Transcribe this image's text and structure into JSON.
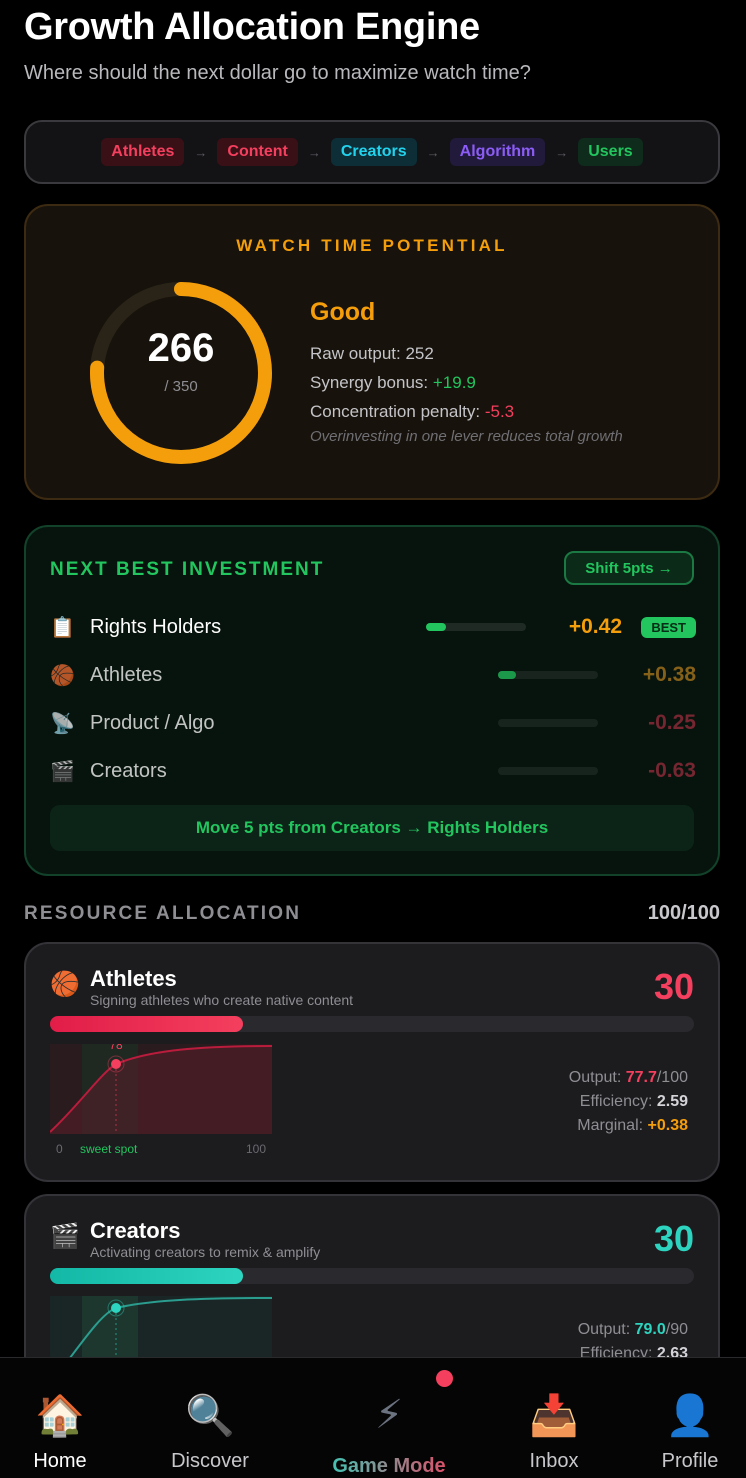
{
  "header": {
    "title": "Growth Allocation Engine",
    "subtitle": "Where should the next dollar go to maximize watch time?"
  },
  "flow": [
    {
      "label": "Athletes",
      "color": "#f43f5e",
      "bg": "#3a1017"
    },
    {
      "label": "Content",
      "color": "#f43f5e",
      "bg": "#3a1017"
    },
    {
      "label": "Creators",
      "color": "#22d3ee",
      "bg": "#0d2e36"
    },
    {
      "label": "Algorithm",
      "color": "#8b5cf6",
      "bg": "#221a3b"
    },
    {
      "label": "Users",
      "color": "#22c55e",
      "bg": "#0e2b1b"
    }
  ],
  "flow_arrow": "→",
  "watch_time": {
    "label": "WATCH TIME POTENTIAL",
    "score": "266",
    "max": "/ 350",
    "score_fraction": 0.76,
    "rating": "Good",
    "raw_label": "Raw output: ",
    "raw_value": "252",
    "synergy_label": "Synergy bonus: ",
    "synergy_value": "+19.9",
    "penalty_label": "Concentration penalty: ",
    "penalty_value": "-5.3",
    "note": "Overinvesting in one lever reduces total growth"
  },
  "next_best": {
    "label": "NEXT BEST INVESTMENT",
    "shift_button": "Shift 5pts →",
    "rows": [
      {
        "icon": "📋",
        "name": "Rights Holders",
        "value": "+0.42",
        "color": "#f59e0b",
        "bar": 0.2,
        "badge": "BEST"
      },
      {
        "icon": "🏀",
        "name": "Athletes",
        "value": "+0.38",
        "color": "#b07a1e",
        "bar": 0.18
      },
      {
        "icon": "📡",
        "name": "Product / Algo",
        "value": "-0.25",
        "color": "#9b2c3d",
        "bar": 0
      },
      {
        "icon": "🎬",
        "name": "Creators",
        "value": "-0.63",
        "color": "#9b2c3d",
        "bar": 0
      }
    ],
    "move_text": "Move 5 pts from Creators → Rights Holders"
  },
  "resources": {
    "label": "RESOURCE ALLOCATION",
    "total": "100/100",
    "cards": [
      {
        "icon": "🏀",
        "name": "Athletes",
        "desc": "Signing athletes who create native content",
        "value": "30",
        "color": "#f43f5e",
        "allocation": 0.3,
        "point_label": "78",
        "axis_min": "0",
        "sweet_label": "sweet spot",
        "axis_max": "100",
        "output_label": "Output: ",
        "output_value": "77.7",
        "output_max": "/100",
        "eff_label": "Efficiency: ",
        "eff_value": "2.59",
        "marg_label": "Marginal: ",
        "marg_value": "+0.38"
      },
      {
        "icon": "🎬",
        "name": "Creators",
        "desc": "Activating creators to remix & amplify",
        "value": "30",
        "color": "#2dd4bf",
        "allocation": 0.3,
        "output_label": "Output: ",
        "output_value": "79.0",
        "output_max": "/90",
        "eff_label": "Efficiency: ",
        "eff_value": "2.63"
      }
    ]
  },
  "tabs": [
    {
      "icon": "🏠",
      "label": "Home"
    },
    {
      "icon": "🔍",
      "label": "Discover"
    },
    {
      "icon": "⚡",
      "label": "Game Mode"
    },
    {
      "icon": "📥",
      "label": "Inbox"
    },
    {
      "icon": "👤",
      "label": "Profile"
    }
  ]
}
